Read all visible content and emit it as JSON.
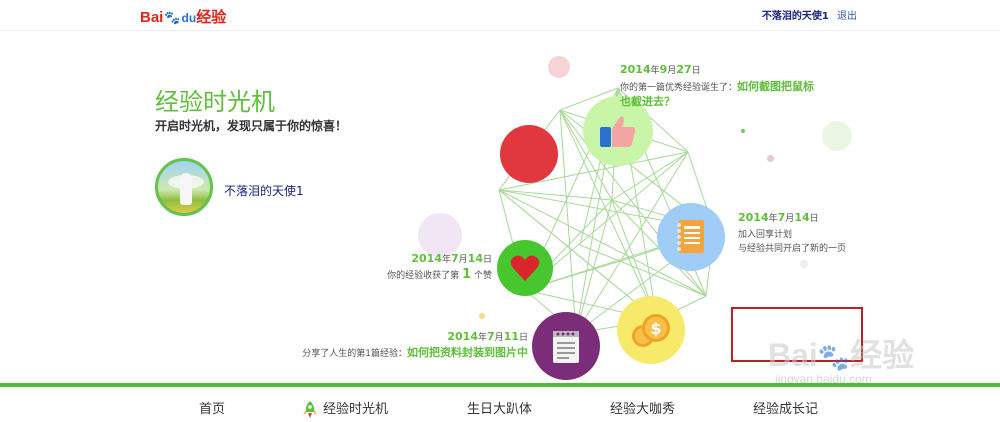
{
  "header": {
    "logo_bai": "Bai",
    "logo_du": "du",
    "logo_jingyan": "经验",
    "username": "不落泪的天使1",
    "logout": "退出"
  },
  "hero": {
    "title": "经验时光机",
    "subtitle": "开启时光机，发现只属于你的惊喜！"
  },
  "profile": {
    "name": "不落泪的天使1"
  },
  "timeline": {
    "e1": {
      "date_year": "2014",
      "date_year_unit": "年",
      "date_month": "9",
      "date_month_unit": "月",
      "date_day": "27",
      "date_day_unit": "日",
      "text": "你的第一篇优秀经验诞生了：",
      "link": "如何截图把鼠标也截进去？"
    },
    "e2": {
      "date_year": "2014",
      "date_year_unit": "年",
      "date_month": "7",
      "date_month_unit": "月",
      "date_day": "14",
      "date_day_unit": "日",
      "line1": "加入回享计划",
      "line2": "与经验共同开启了新的一页"
    },
    "e3": {
      "date_year": "2014",
      "date_year_unit": "年",
      "date_month": "7",
      "date_month_unit": "月",
      "date_day": "14",
      "date_day_unit": "日",
      "text_a": "你的经验收获了第",
      "count": "1",
      "text_b": "个赞"
    },
    "e4": {
      "date_year": "2014",
      "date_year_unit": "年",
      "date_month": "7",
      "date_month_unit": "月",
      "date_day": "11",
      "date_day_unit": "日",
      "text": "分享了人生的第1篇经验：",
      "link": "如何把资料封装到图片中"
    }
  },
  "colors": {
    "accent_green": "#5fbf3a",
    "node_red": "#e0383e",
    "node_green": "#47c62e",
    "node_purple": "#7b2d7a",
    "node_yellow": "#f7e96a",
    "node_blue": "#9fcdf5",
    "node_lightgreen": "#c9f5a8"
  },
  "icons": {
    "thumbs_up": "thumbs-up-icon",
    "notebook": "notebook-icon",
    "heart": "heart-icon",
    "coins": "coins-icon",
    "notepad": "notepad-icon",
    "rocket": "rocket-icon"
  },
  "watermark": {
    "brand_a": "Bai",
    "brand_b": "经验",
    "url": "jingyan.baidu.com"
  },
  "nav": {
    "home": "首页",
    "time_machine": "经验时光机",
    "birthday": "生日大趴体",
    "show": "经验大咖秀",
    "growth": "经验成长记"
  }
}
